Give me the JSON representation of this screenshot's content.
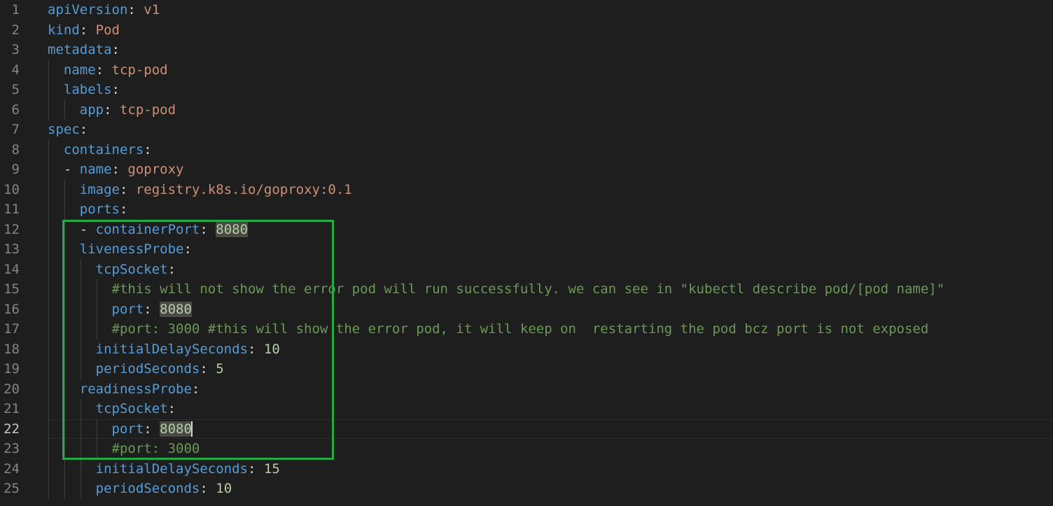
{
  "editor": {
    "language": "yaml",
    "current_line": "22",
    "lines": [
      {
        "num": "1",
        "tokens": [
          {
            "t": "k",
            "v": "apiVersion"
          },
          {
            "t": "p",
            "v": ": "
          },
          {
            "t": "s",
            "v": "v1"
          }
        ]
      },
      {
        "num": "2",
        "tokens": [
          {
            "t": "k",
            "v": "kind"
          },
          {
            "t": "p",
            "v": ": "
          },
          {
            "t": "s",
            "v": "Pod"
          }
        ]
      },
      {
        "num": "3",
        "tokens": [
          {
            "t": "k",
            "v": "metadata"
          },
          {
            "t": "p",
            "v": ":"
          }
        ]
      },
      {
        "num": "4",
        "tokens": [
          {
            "t": "p",
            "v": "  "
          },
          {
            "t": "k",
            "v": "name"
          },
          {
            "t": "p",
            "v": ": "
          },
          {
            "t": "s",
            "v": "tcp-pod"
          }
        ]
      },
      {
        "num": "5",
        "tokens": [
          {
            "t": "p",
            "v": "  "
          },
          {
            "t": "k",
            "v": "labels"
          },
          {
            "t": "p",
            "v": ":"
          }
        ]
      },
      {
        "num": "6",
        "tokens": [
          {
            "t": "p",
            "v": "    "
          },
          {
            "t": "k",
            "v": "app"
          },
          {
            "t": "p",
            "v": ": "
          },
          {
            "t": "s",
            "v": "tcp-pod"
          }
        ]
      },
      {
        "num": "7",
        "tokens": [
          {
            "t": "k",
            "v": "spec"
          },
          {
            "t": "p",
            "v": ":"
          }
        ]
      },
      {
        "num": "8",
        "tokens": [
          {
            "t": "p",
            "v": "  "
          },
          {
            "t": "k",
            "v": "containers"
          },
          {
            "t": "p",
            "v": ":"
          }
        ]
      },
      {
        "num": "9",
        "tokens": [
          {
            "t": "p",
            "v": "  - "
          },
          {
            "t": "k",
            "v": "name"
          },
          {
            "t": "p",
            "v": ": "
          },
          {
            "t": "s",
            "v": "goproxy"
          }
        ]
      },
      {
        "num": "10",
        "tokens": [
          {
            "t": "p",
            "v": "    "
          },
          {
            "t": "k",
            "v": "image"
          },
          {
            "t": "p",
            "v": ": "
          },
          {
            "t": "s",
            "v": "registry.k8s.io/goproxy:0.1"
          }
        ]
      },
      {
        "num": "11",
        "tokens": [
          {
            "t": "p",
            "v": "    "
          },
          {
            "t": "k",
            "v": "ports"
          },
          {
            "t": "p",
            "v": ":"
          }
        ]
      },
      {
        "num": "12",
        "tokens": [
          {
            "t": "p",
            "v": "    - "
          },
          {
            "t": "k",
            "v": "containerPort"
          },
          {
            "t": "p",
            "v": ": "
          },
          {
            "t": "nh",
            "v": "8080"
          }
        ]
      },
      {
        "num": "13",
        "tokens": [
          {
            "t": "p",
            "v": "    "
          },
          {
            "t": "k",
            "v": "livenessProbe"
          },
          {
            "t": "p",
            "v": ":"
          }
        ]
      },
      {
        "num": "14",
        "tokens": [
          {
            "t": "p",
            "v": "      "
          },
          {
            "t": "k",
            "v": "tcpSocket"
          },
          {
            "t": "p",
            "v": ":"
          }
        ]
      },
      {
        "num": "15",
        "tokens": [
          {
            "t": "p",
            "v": "        "
          },
          {
            "t": "c",
            "v": "#this will not show the error pod will run successfully. we can see in \"kubectl describe pod/[pod name]\""
          }
        ]
      },
      {
        "num": "16",
        "tokens": [
          {
            "t": "p",
            "v": "        "
          },
          {
            "t": "k",
            "v": "port"
          },
          {
            "t": "p",
            "v": ": "
          },
          {
            "t": "nh",
            "v": "8080"
          }
        ]
      },
      {
        "num": "17",
        "tokens": [
          {
            "t": "p",
            "v": "        "
          },
          {
            "t": "c",
            "v": "#port: 3000 #this will show the error pod, it will keep on  restarting the pod bcz port is not exposed"
          }
        ]
      },
      {
        "num": "18",
        "tokens": [
          {
            "t": "p",
            "v": "      "
          },
          {
            "t": "k",
            "v": "initialDelaySeconds"
          },
          {
            "t": "p",
            "v": ": "
          },
          {
            "t": "n",
            "v": "10"
          }
        ]
      },
      {
        "num": "19",
        "tokens": [
          {
            "t": "p",
            "v": "      "
          },
          {
            "t": "k",
            "v": "periodSeconds"
          },
          {
            "t": "p",
            "v": ": "
          },
          {
            "t": "n",
            "v": "5"
          }
        ]
      },
      {
        "num": "20",
        "tokens": [
          {
            "t": "p",
            "v": "    "
          },
          {
            "t": "k",
            "v": "readinessProbe"
          },
          {
            "t": "p",
            "v": ":"
          }
        ]
      },
      {
        "num": "21",
        "tokens": [
          {
            "t": "p",
            "v": "      "
          },
          {
            "t": "k",
            "v": "tcpSocket"
          },
          {
            "t": "p",
            "v": ":"
          }
        ]
      },
      {
        "num": "22",
        "tokens": [
          {
            "t": "p",
            "v": "        "
          },
          {
            "t": "k",
            "v": "port"
          },
          {
            "t": "p",
            "v": ": "
          },
          {
            "t": "nh",
            "v": "8080"
          },
          {
            "t": "cursor",
            "v": ""
          }
        ]
      },
      {
        "num": "23",
        "tokens": [
          {
            "t": "p",
            "v": "        "
          },
          {
            "t": "c",
            "v": "#port: 3000"
          }
        ]
      },
      {
        "num": "24",
        "tokens": [
          {
            "t": "p",
            "v": "      "
          },
          {
            "t": "k",
            "v": "initialDelaySeconds"
          },
          {
            "t": "p",
            "v": ": "
          },
          {
            "t": "n",
            "v": "15"
          }
        ]
      },
      {
        "num": "25",
        "tokens": [
          {
            "t": "p",
            "v": "      "
          },
          {
            "t": "k",
            "v": "periodSeconds"
          },
          {
            "t": "p",
            "v": ": "
          },
          {
            "t": "n",
            "v": "10"
          }
        ]
      }
    ]
  },
  "annotation": {
    "box_color": "#22aa44"
  }
}
